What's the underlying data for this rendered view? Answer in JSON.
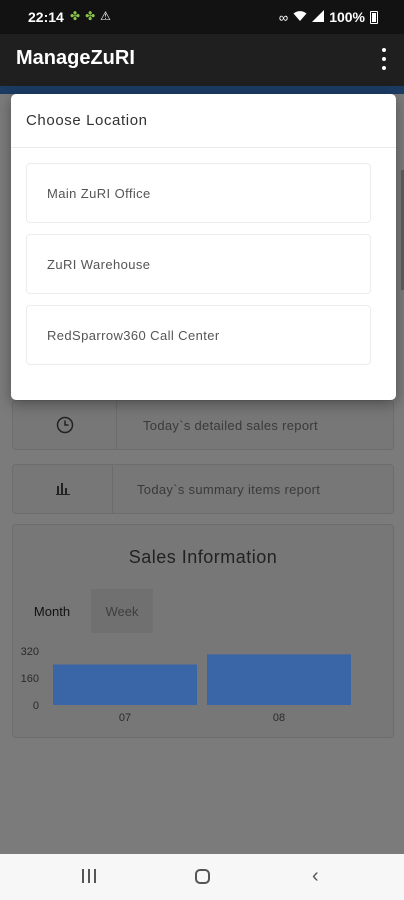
{
  "status_bar": {
    "time": "22:14",
    "battery": "100%",
    "left_icons": [
      "android-icon",
      "android-icon",
      "warning-icon"
    ],
    "right_icons": [
      "link-icon",
      "wifi-icon",
      "signal-icon",
      "battery-icon"
    ]
  },
  "app_bar": {
    "title": "ManageZuRI"
  },
  "dialog": {
    "title": "Choose Location",
    "locations": [
      {
        "label": "Main ZuRI Office"
      },
      {
        "label": "ZuRI Warehouse"
      },
      {
        "label": "RedSparrow360 Call Center"
      }
    ]
  },
  "reports": {
    "detailed_label": "Today`s detailed sales report",
    "summary_label": "Today`s summary items report"
  },
  "sales": {
    "title": "Sales Information",
    "tabs": [
      {
        "label": "Month"
      },
      {
        "label": "Week"
      }
    ]
  },
  "chart_data": {
    "type": "bar",
    "categories": [
      "07",
      "08"
    ],
    "values": [
      240,
      300
    ],
    "y_ticks": [
      "320",
      "160",
      "0"
    ],
    "ylim": [
      0,
      320
    ],
    "bar_color": "#3a66a8"
  },
  "colors": {
    "app_bar": "#1f1f1f",
    "accent_band": "#1c3b63",
    "bar": "#3a66a8"
  }
}
